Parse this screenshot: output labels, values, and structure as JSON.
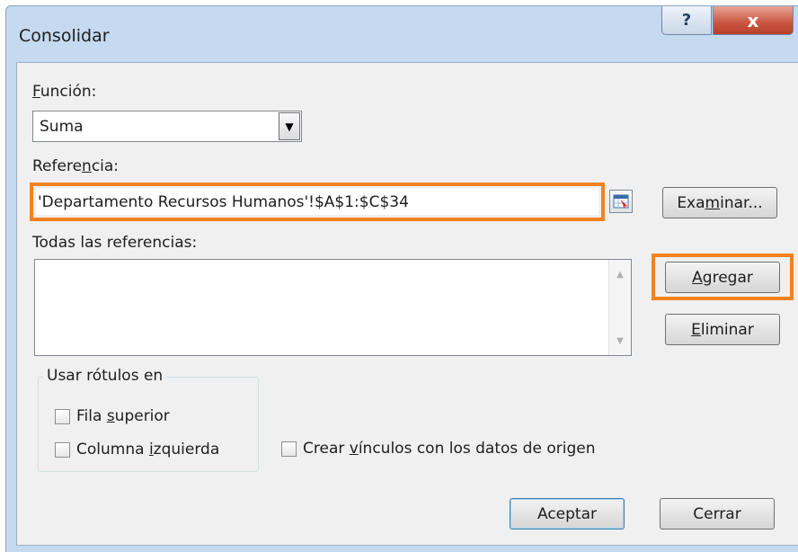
{
  "window": {
    "title": "Consolidar",
    "help_label": "?",
    "close_label": "x"
  },
  "funcion": {
    "label_first": "F",
    "label_rest": "unción:",
    "selected": "Suma",
    "arrow": "▼"
  },
  "referencia": {
    "label_pre": "Refere",
    "label_u": "n",
    "label_post": "cia:",
    "value": "'Departamento Recursos Humanos'!$A$1:$C$34"
  },
  "buttons": {
    "examinar_pre": "Exa",
    "examinar_u": "m",
    "examinar_post": "inar...",
    "agregar_u": "A",
    "agregar_post": "gregar",
    "eliminar_u": "E",
    "eliminar_post": "liminar",
    "aceptar": "Aceptar",
    "cerrar": "Cerrar"
  },
  "todas": {
    "label": "Todas las referencias:",
    "scroll_up": "▲",
    "scroll_down": "▼"
  },
  "rotulos": {
    "legend": "Usar rótulos en",
    "fila_pre": "Fila ",
    "fila_u": "s",
    "fila_post": "uperior",
    "columna_pre": "Columna ",
    "columna_u": "i",
    "columna_post": "zquierda"
  },
  "vinculos": {
    "pre": "Crear ",
    "u": "v",
    "post": "ínculos con los datos de origen"
  },
  "colors": {
    "highlight": "#f4821f",
    "frame": "#c5d9ef",
    "close": "#c9553f"
  }
}
